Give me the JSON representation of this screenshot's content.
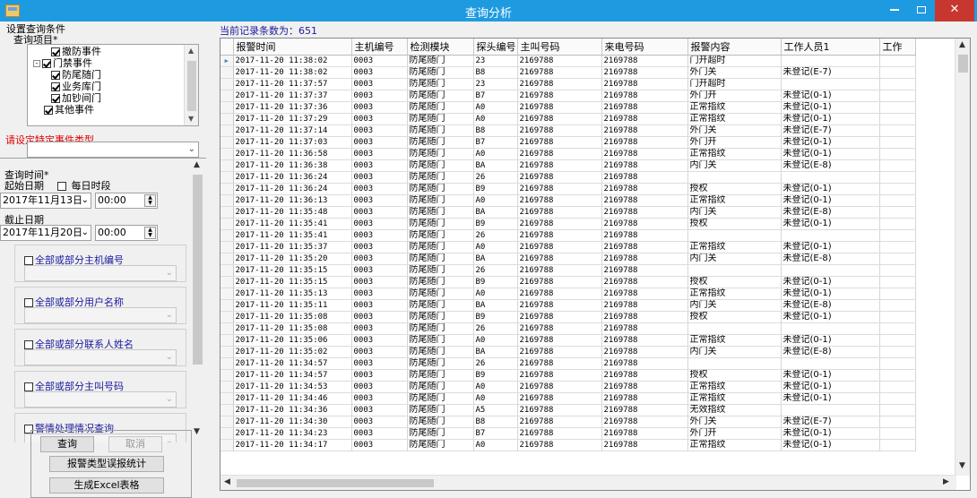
{
  "window": {
    "title": "查询分析"
  },
  "left": {
    "section_title": "设置查询条件",
    "query_items_label": "查询项目*",
    "tree": [
      {
        "label": "撤防事件",
        "checked": true,
        "level": 2
      },
      {
        "label": "门禁事件",
        "checked": true,
        "level": 1,
        "expander": "-"
      },
      {
        "label": "防尾随门",
        "checked": true,
        "level": 2
      },
      {
        "label": "业务库门",
        "checked": true,
        "level": 2
      },
      {
        "label": "加钞间门",
        "checked": true,
        "level": 2
      },
      {
        "label": "其他事件",
        "checked": true,
        "level": 1
      }
    ],
    "event_type_note": "请设定特定事件类型",
    "query_time_label": "查询时间*",
    "start_date_label": "起始日期",
    "daily_period_label": "每日时段",
    "start_date": "2017年11月13日",
    "start_time": "00:00",
    "end_date_label": "截止日期",
    "end_date": "2017年11月20日",
    "end_time": "00:00",
    "filters": [
      "全部或部分主机编号",
      "全部或部分用户名称",
      "全部或部分联系人姓名",
      "全部或部分主叫号码",
      "警情处理情况查询"
    ],
    "buttons": {
      "query": "查询",
      "cancel": "取消",
      "stats": "报警类型误报统计",
      "excel": "生成Excel表格"
    }
  },
  "right": {
    "count_label": "当前记录条数为：651",
    "columns": [
      "报警时间",
      "主机编号",
      "检测模块",
      "探头编号",
      "主叫号码",
      "来电号码",
      "报警内容",
      "工作人员1",
      "工作"
    ],
    "rows": [
      [
        "2017-11-20 11:38:02",
        "0003",
        "防尾随门",
        "23",
        "2169788",
        "2169788",
        "门开超时",
        ""
      ],
      [
        "2017-11-20 11:38:02",
        "0003",
        "防尾随门",
        "B8",
        "2169788",
        "2169788",
        "外门关",
        "未登记(E-7)"
      ],
      [
        "2017-11-20 11:37:57",
        "0003",
        "防尾随门",
        "23",
        "2169788",
        "2169788",
        "门开超时",
        ""
      ],
      [
        "2017-11-20 11:37:37",
        "0003",
        "防尾随门",
        "B7",
        "2169788",
        "2169788",
        "外门开",
        "未登记(0-1)"
      ],
      [
        "2017-11-20 11:37:36",
        "0003",
        "防尾随门",
        "A0",
        "2169788",
        "2169788",
        "正常指纹",
        "未登记(0-1)"
      ],
      [
        "2017-11-20 11:37:29",
        "0003",
        "防尾随门",
        "A0",
        "2169788",
        "2169788",
        "正常指纹",
        "未登记(0-1)"
      ],
      [
        "2017-11-20 11:37:14",
        "0003",
        "防尾随门",
        "B8",
        "2169788",
        "2169788",
        "外门关",
        "未登记(E-7)"
      ],
      [
        "2017-11-20 11:37:03",
        "0003",
        "防尾随门",
        "B7",
        "2169788",
        "2169788",
        "外门开",
        "未登记(0-1)"
      ],
      [
        "2017-11-20 11:36:58",
        "0003",
        "防尾随门",
        "A0",
        "2169788",
        "2169788",
        "正常指纹",
        "未登记(0-1)"
      ],
      [
        "2017-11-20 11:36:38",
        "0003",
        "防尾随门",
        "BA",
        "2169788",
        "2169788",
        "内门关",
        "未登记(E-8)"
      ],
      [
        "2017-11-20 11:36:24",
        "0003",
        "防尾随门",
        "26",
        "2169788",
        "2169788",
        "",
        ""
      ],
      [
        "2017-11-20 11:36:24",
        "0003",
        "防尾随门",
        "B9",
        "2169788",
        "2169788",
        "授权",
        "未登记(0-1)"
      ],
      [
        "2017-11-20 11:36:13",
        "0003",
        "防尾随门",
        "A0",
        "2169788",
        "2169788",
        "正常指纹",
        "未登记(0-1)"
      ],
      [
        "2017-11-20 11:35:48",
        "0003",
        "防尾随门",
        "BA",
        "2169788",
        "2169788",
        "内门关",
        "未登记(E-8)"
      ],
      [
        "2017-11-20 11:35:41",
        "0003",
        "防尾随门",
        "B9",
        "2169788",
        "2169788",
        "授权",
        "未登记(0-1)"
      ],
      [
        "2017-11-20 11:35:41",
        "0003",
        "防尾随门",
        "26",
        "2169788",
        "2169788",
        "",
        ""
      ],
      [
        "2017-11-20 11:35:37",
        "0003",
        "防尾随门",
        "A0",
        "2169788",
        "2169788",
        "正常指纹",
        "未登记(0-1)"
      ],
      [
        "2017-11-20 11:35:20",
        "0003",
        "防尾随门",
        "BA",
        "2169788",
        "2169788",
        "内门关",
        "未登记(E-8)"
      ],
      [
        "2017-11-20 11:35:15",
        "0003",
        "防尾随门",
        "26",
        "2169788",
        "2169788",
        "",
        ""
      ],
      [
        "2017-11-20 11:35:15",
        "0003",
        "防尾随门",
        "B9",
        "2169788",
        "2169788",
        "授权",
        "未登记(0-1)"
      ],
      [
        "2017-11-20 11:35:13",
        "0003",
        "防尾随门",
        "A0",
        "2169788",
        "2169788",
        "正常指纹",
        "未登记(0-1)"
      ],
      [
        "2017-11-20 11:35:11",
        "0003",
        "防尾随门",
        "BA",
        "2169788",
        "2169788",
        "内门关",
        "未登记(E-8)"
      ],
      [
        "2017-11-20 11:35:08",
        "0003",
        "防尾随门",
        "B9",
        "2169788",
        "2169788",
        "授权",
        "未登记(0-1)"
      ],
      [
        "2017-11-20 11:35:08",
        "0003",
        "防尾随门",
        "26",
        "2169788",
        "2169788",
        "",
        ""
      ],
      [
        "2017-11-20 11:35:06",
        "0003",
        "防尾随门",
        "A0",
        "2169788",
        "2169788",
        "正常指纹",
        "未登记(0-1)"
      ],
      [
        "2017-11-20 11:35:02",
        "0003",
        "防尾随门",
        "BA",
        "2169788",
        "2169788",
        "内门关",
        "未登记(E-8)"
      ],
      [
        "2017-11-20 11:34:57",
        "0003",
        "防尾随门",
        "26",
        "2169788",
        "2169788",
        "",
        ""
      ],
      [
        "2017-11-20 11:34:57",
        "0003",
        "防尾随门",
        "B9",
        "2169788",
        "2169788",
        "授权",
        "未登记(0-1)"
      ],
      [
        "2017-11-20 11:34:53",
        "0003",
        "防尾随门",
        "A0",
        "2169788",
        "2169788",
        "正常指纹",
        "未登记(0-1)"
      ],
      [
        "2017-11-20 11:34:46",
        "0003",
        "防尾随门",
        "A0",
        "2169788",
        "2169788",
        "正常指纹",
        "未登记(0-1)"
      ],
      [
        "2017-11-20 11:34:36",
        "0003",
        "防尾随门",
        "A5",
        "2169788",
        "2169788",
        "无效指纹",
        ""
      ],
      [
        "2017-11-20 11:34:30",
        "0003",
        "防尾随门",
        "B8",
        "2169788",
        "2169788",
        "外门关",
        "未登记(E-7)"
      ],
      [
        "2017-11-20 11:34:23",
        "0003",
        "防尾随门",
        "B7",
        "2169788",
        "2169788",
        "外门开",
        "未登记(0-1)"
      ],
      [
        "2017-11-20 11:34:17",
        "0003",
        "防尾随门",
        "A0",
        "2169788",
        "2169788",
        "正常指纹",
        "未登记(0-1)"
      ]
    ]
  },
  "colors": {
    "titlebar": "#1e9be0",
    "close": "#c7372f",
    "note": "#e00000",
    "label_blue": "#1a1aa0"
  }
}
